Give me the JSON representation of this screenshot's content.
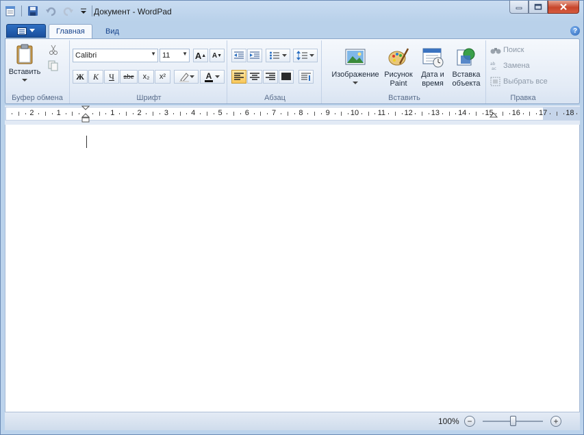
{
  "window": {
    "title": "Документ - WordPad"
  },
  "tabs": {
    "home": "Главная",
    "view": "Вид",
    "help": "?"
  },
  "clipboard": {
    "paste_label": "Вставить",
    "group_label": "Буфер обмена"
  },
  "font": {
    "family": "Calibri",
    "size": "11",
    "bold": "Ж",
    "italic": "К",
    "underline": "Ч",
    "strikethrough": "abe",
    "subscript": "x₂",
    "superscript": "x²",
    "grow": "A",
    "shrink": "A",
    "color_letter": "A",
    "group_label": "Шрифт"
  },
  "paragraph": {
    "group_label": "Абзац"
  },
  "insert": {
    "picture": "Изображение",
    "paint": "Рисунок Paint",
    "datetime": "Дата и время",
    "object": "Вставка объекта",
    "group_label": "Вставить"
  },
  "editing": {
    "find": "Поиск",
    "replace": "Замена",
    "select_all": "Выбрать все",
    "group_label": "Правка"
  },
  "ruler": {
    "labels": [
      "2",
      "1",
      "1",
      "2",
      "3",
      "4",
      "5",
      "6",
      "7",
      "8",
      "9",
      "10",
      "11",
      "12",
      "13",
      "14",
      "15",
      "16",
      "17",
      "18"
    ]
  },
  "status": {
    "zoom": "100%",
    "zoom_out": "−",
    "zoom_in": "+",
    "zoom_level_fraction": 0.5
  },
  "colors": {
    "accent": "#2e6fc2",
    "ribbon_bg": "#e3ebf6",
    "active_button": "#f8c75a",
    "close_button": "#c7452b"
  }
}
